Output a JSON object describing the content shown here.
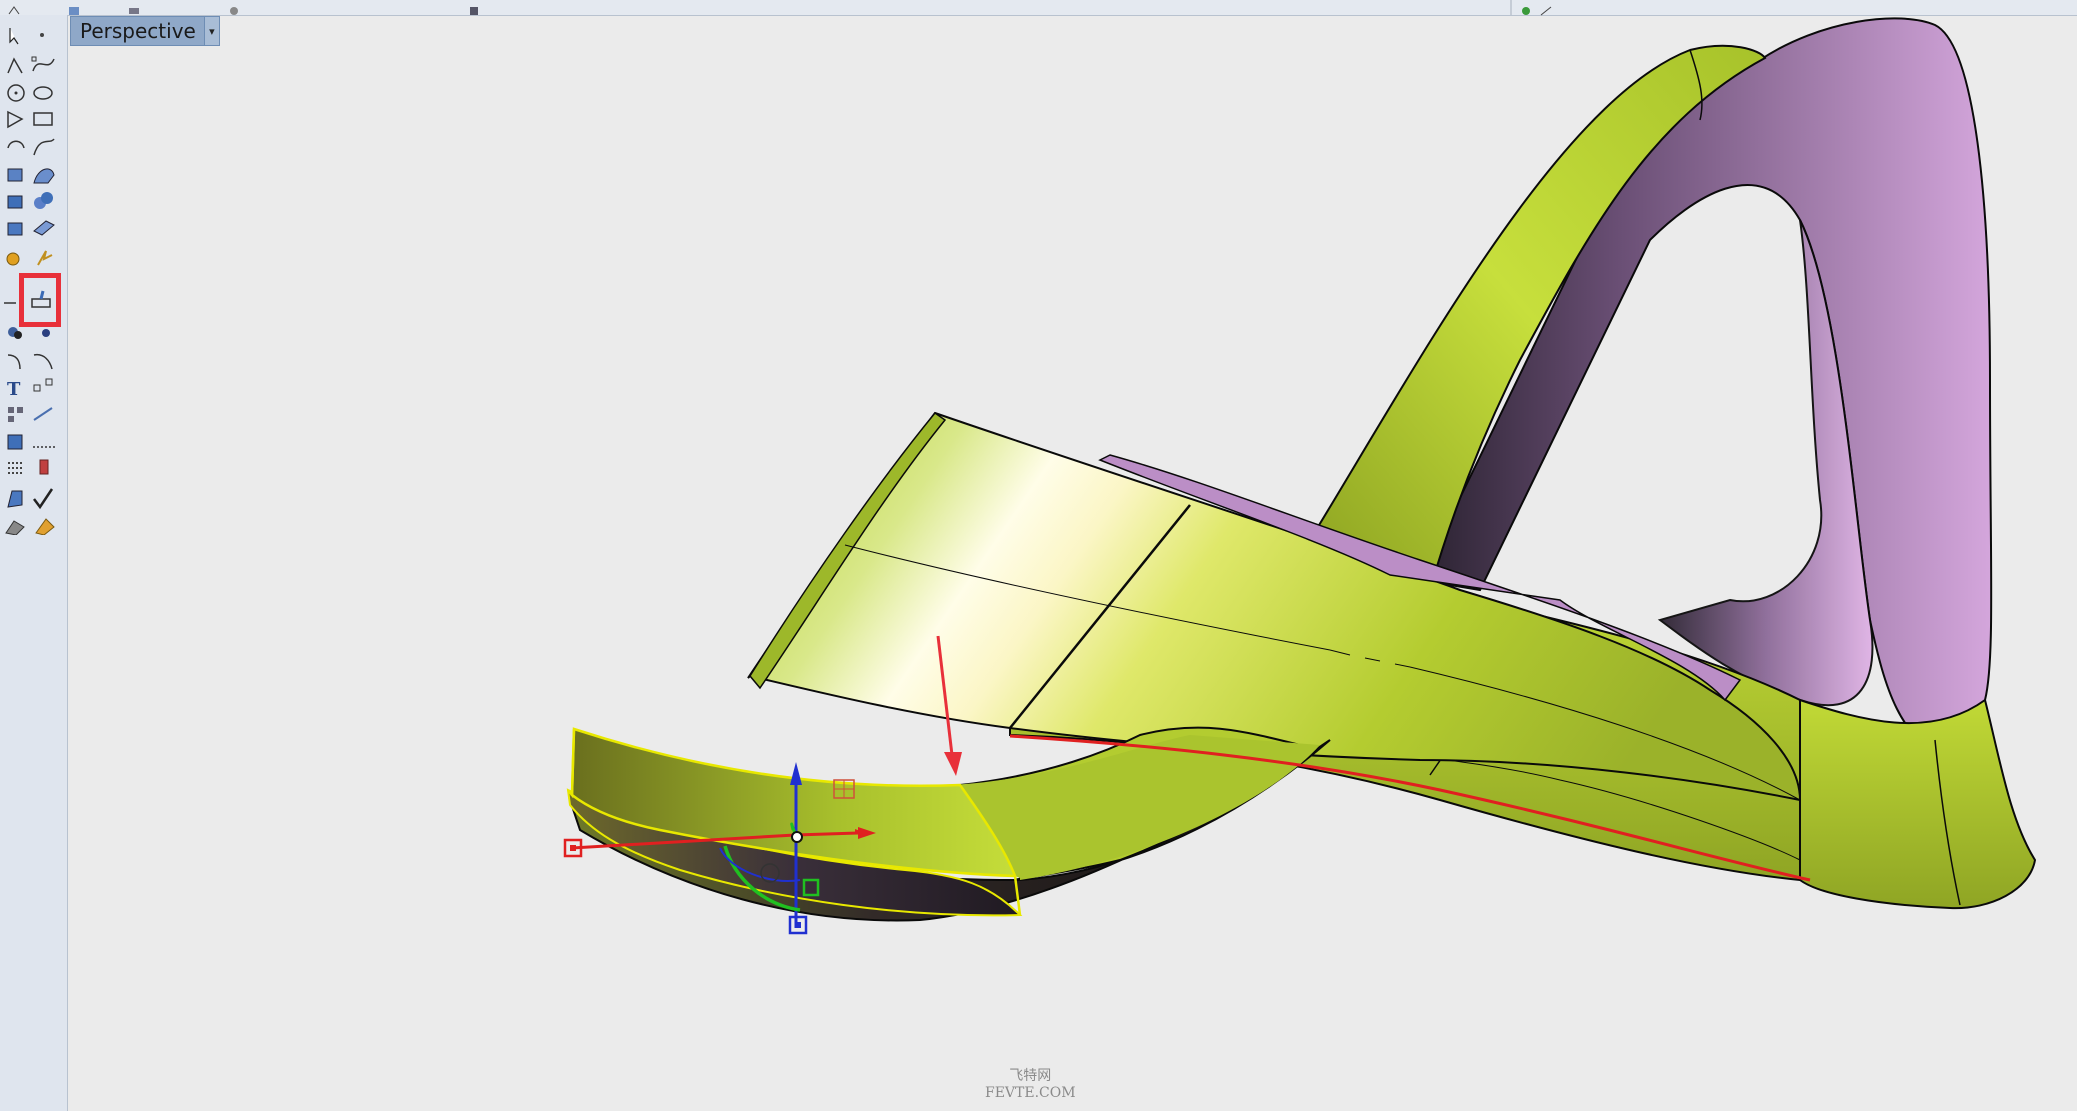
{
  "viewport": {
    "name": "Perspective",
    "dropdown_icon": "caret-down-icon"
  },
  "watermark": {
    "chinese": "飞特网",
    "english": "FEVTE.COM"
  },
  "toolbar": {
    "highlighted_tool": "extend-surface-icon",
    "highlight_color": "#e8303a",
    "tools": [
      "select-arrow-icon",
      "point-icon",
      "polyline-icon",
      "curve-cv-icon",
      "circle-icon",
      "ellipse-icon",
      "polygon-icon",
      "rectangle-icon",
      "arc-icon",
      "curve-blend-icon",
      "surface-cv-icon",
      "sweep-icon",
      "box-solid-icon",
      "sphere-solid-icon",
      "cylinder-icon",
      "plane-surface-icon",
      "gear-icon",
      "lightning-icon",
      "trim-icon",
      "extend-surface-icon",
      "boolean-icon",
      "point-on-icon",
      "fillet-curve-icon",
      "blend-curve-icon",
      "text-icon",
      "scale-icon",
      "array-icon",
      "dimension-icon",
      "block-icon",
      "hatch-icon",
      "grid-array-icon",
      "inspect-icon",
      "render-icon",
      "check-icon",
      "solid-tools-icon",
      "paint-icon"
    ]
  },
  "colors": {
    "surface_yellow": "#b8d42a",
    "surface_highlight": "#fffbe6",
    "surface_purple": "#c79ad0",
    "surface_dark": "#2b2420",
    "selection_yellow": "#e8e800",
    "gumball_x": "#e02020",
    "gumball_y": "#20c020",
    "gumball_z": "#2030d0",
    "annotation_arrow": "#e8303a"
  }
}
